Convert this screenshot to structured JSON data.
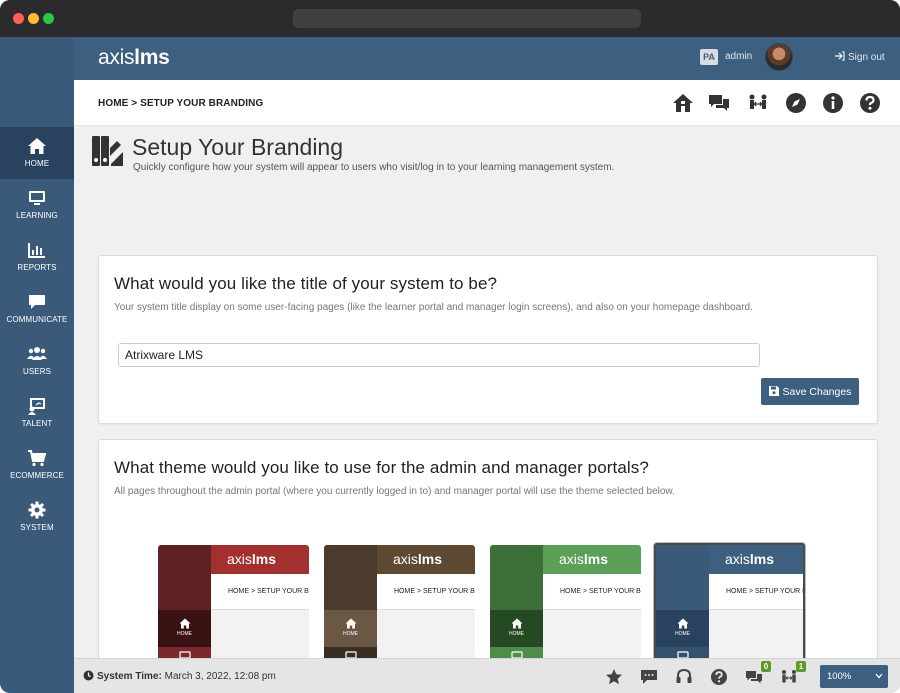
{
  "header": {
    "logo_light": "axis",
    "logo_bold": "lms",
    "user_initials": "PA",
    "user_name": "admin",
    "signout_label": "Sign out"
  },
  "breadcrumb": {
    "home": "HOME",
    "separator": ">",
    "current": "SETUP YOUR BRANDING"
  },
  "sidebar": {
    "items": [
      {
        "label": "HOME",
        "icon": "home-icon",
        "active": true
      },
      {
        "label": "LEARNING",
        "icon": "monitor-icon"
      },
      {
        "label": "REPORTS",
        "icon": "bar-chart-icon"
      },
      {
        "label": "COMMUNICATE",
        "icon": "chat-icon"
      },
      {
        "label": "USERS",
        "icon": "users-icon"
      },
      {
        "label": "TALENT",
        "icon": "presentation-icon"
      },
      {
        "label": "ECOMMERCE",
        "icon": "cart-icon"
      },
      {
        "label": "SYSTEM",
        "icon": "gear-icon"
      }
    ]
  },
  "toolbar_icons": [
    "home-icon",
    "chat-bubbles-icon",
    "users-arrows-icon",
    "compass-icon",
    "info-icon",
    "help-icon"
  ],
  "page": {
    "title": "Setup Your Branding",
    "subtitle": "Quickly configure how your system will appear to users who visit/log in to your learning management system."
  },
  "title_section": {
    "heading": "What would you like the title of your system to be?",
    "description": "Your system title display on some user-facing pages (like the learner portal and manager login screens), and also on your homepage dashboard.",
    "input_value": "Atrixware LMS",
    "save_label": "Save Changes"
  },
  "theme_section": {
    "heading": "What theme would you like to use for the admin and manager portals?",
    "description": "All pages throughout the admin portal (where you currently logged in to) and manager portal will use the theme selected below.",
    "themes": [
      {
        "logo_light": "axis",
        "logo_bold": "lms",
        "crumb": "HOME  > SETUP YOUR BI",
        "home_label": "HOME",
        "side": "#5e2225",
        "top": "#a2302e",
        "home": "#3a1214",
        "lrn": "#7a2a2c",
        "selected": false
      },
      {
        "logo_light": "axis",
        "logo_bold": "lms",
        "crumb": "HOME  > SETUP YOUR BI",
        "home_label": "HOME",
        "side": "#4a3b2c",
        "top": "#5e4a33",
        "home": "#6a5845",
        "lrn": "#3a2e22",
        "selected": false
      },
      {
        "logo_light": "axis",
        "logo_bold": "lms",
        "crumb": "HOME  > SETUP YOUR BI",
        "home_label": "HOME",
        "side": "#3b6f37",
        "top": "#5b9f58",
        "home": "#254a23",
        "lrn": "#4d8c49",
        "selected": false
      },
      {
        "logo_light": "axis",
        "logo_bold": "lms",
        "crumb": "HOME  > SETUP YOUR BI",
        "home_label": "HOME",
        "side": "#3b5a7a",
        "top": "#3d5f80",
        "home": "#29435f",
        "lrn": "#34516f",
        "selected": true
      }
    ],
    "peek_colors": [
      "#6b6f8a",
      "#444444",
      "#3f87c8"
    ]
  },
  "footer": {
    "time_label": "System Time:",
    "time_value": "March 3, 2022, 12:08 pm",
    "chat_badge": "0",
    "users_badge": "1",
    "zoom": "100%"
  }
}
